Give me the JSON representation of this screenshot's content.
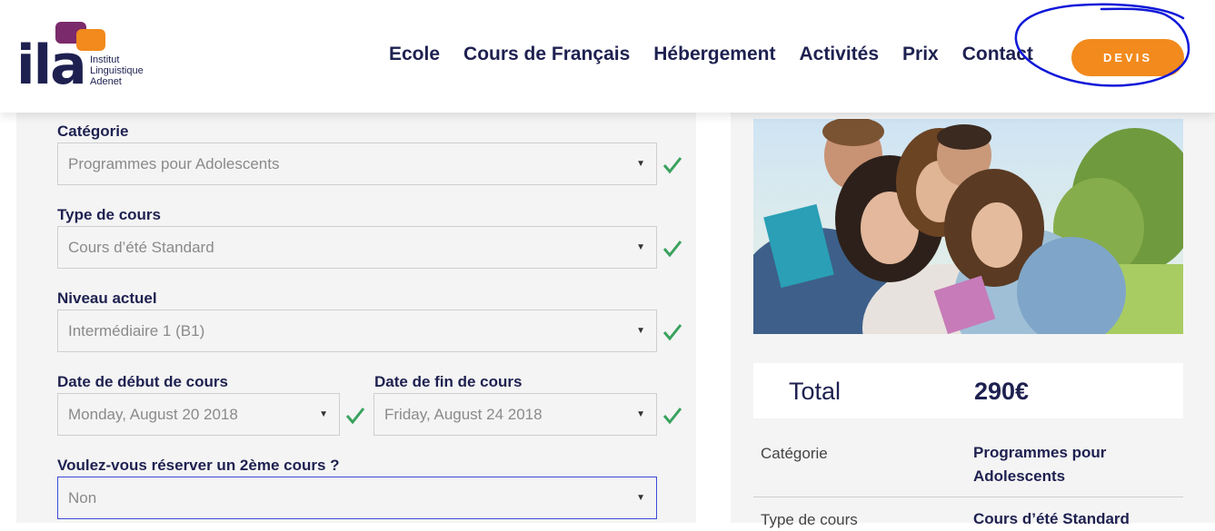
{
  "brand": {
    "mark": "ila",
    "line1": "Institut",
    "line2": "Linguistique",
    "line3": "Adenet",
    "colors": {
      "navy": "#1e2150",
      "orange": "#f28a1d",
      "purple": "#7b2a6b"
    }
  },
  "nav": {
    "items": [
      "Ecole",
      "Cours de Français",
      "Hébergement",
      "Activités",
      "Prix",
      "Contact"
    ],
    "cta": "DEVIS"
  },
  "form": {
    "categorie": {
      "label": "Catégorie",
      "value": "Programmes pour Adolescents"
    },
    "type": {
      "label": "Type de cours",
      "value": "Cours d’été Standard"
    },
    "niveau": {
      "label": "Niveau actuel",
      "value": "Intermédiaire 1 (B1)"
    },
    "date_debut": {
      "label": "Date de début de cours",
      "value": "Monday, August 20 2018"
    },
    "date_fin": {
      "label": "Date de fin de cours",
      "value": "Friday, August 24 2018"
    },
    "second": {
      "label": "Voulez-vous réserver un 2ème cours ?",
      "value": "Non"
    }
  },
  "summary": {
    "total_label": "Total",
    "total_value": "290€",
    "rows": [
      {
        "key": "Catégorie",
        "value": "Programmes pour Adolescents"
      },
      {
        "key": "Type de cours",
        "value": "Cours d’été Standard"
      }
    ]
  },
  "icons": {
    "check": "check-icon",
    "caret": "caret-down-icon"
  }
}
